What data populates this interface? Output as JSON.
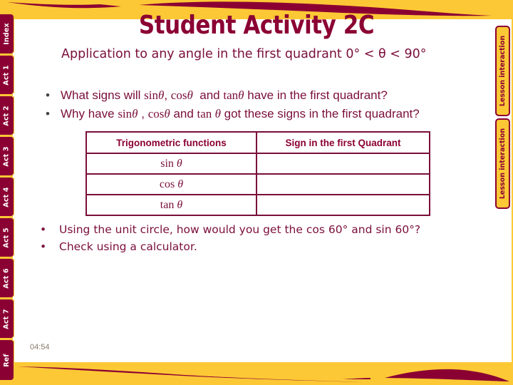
{
  "title": "Student Activity 2C",
  "subtitle": "Application to any angle in the first quadrant 0° < θ < 90°",
  "questions": [
    {
      "pre": "What signs will ",
      "f1": "sin",
      "f1_var": "θ",
      "sep1": ", ",
      "f2": "cos",
      "f2_var": "θ",
      "sep2": "  and ",
      "f3": "tan",
      "f3_var": "θ",
      "post": " have in the first quadrant?"
    },
    {
      "pre": "Why have ",
      "f1": "sin",
      "f1_var": "θ",
      "sep1": " , ",
      "f2": "cos",
      "f2_var": "θ",
      "sep2": " and ",
      "f3": "tan ",
      "f3_var": "θ",
      "post": " got these signs in the first quadrant?"
    }
  ],
  "table": {
    "headers": [
      "Trigonometric functions",
      "Sign in the first Quadrant"
    ],
    "rows": [
      {
        "function": "sin",
        "var": "θ",
        "sign": ""
      },
      {
        "function": "cos",
        "var": "θ",
        "sign": ""
      },
      {
        "function": "tan",
        "var": "θ",
        "sign": ""
      }
    ]
  },
  "tasks": [
    "Using the unit circle, how would you get the cos 60° and sin 60°?",
    "Check using a calculator."
  ],
  "left_tabs": [
    "Index",
    "Act 1",
    "Act 2",
    "Act 3",
    "Act 4",
    "Act 5",
    "Act 6",
    "Act 7",
    "Ref"
  ],
  "right_buttons": [
    "Lesson interaction",
    "Lesson interaction"
  ],
  "timestamp": "04:54",
  "colors": {
    "maroon": "#8b0033",
    "gold": "#fdc835",
    "text": "#7a0e3a"
  }
}
